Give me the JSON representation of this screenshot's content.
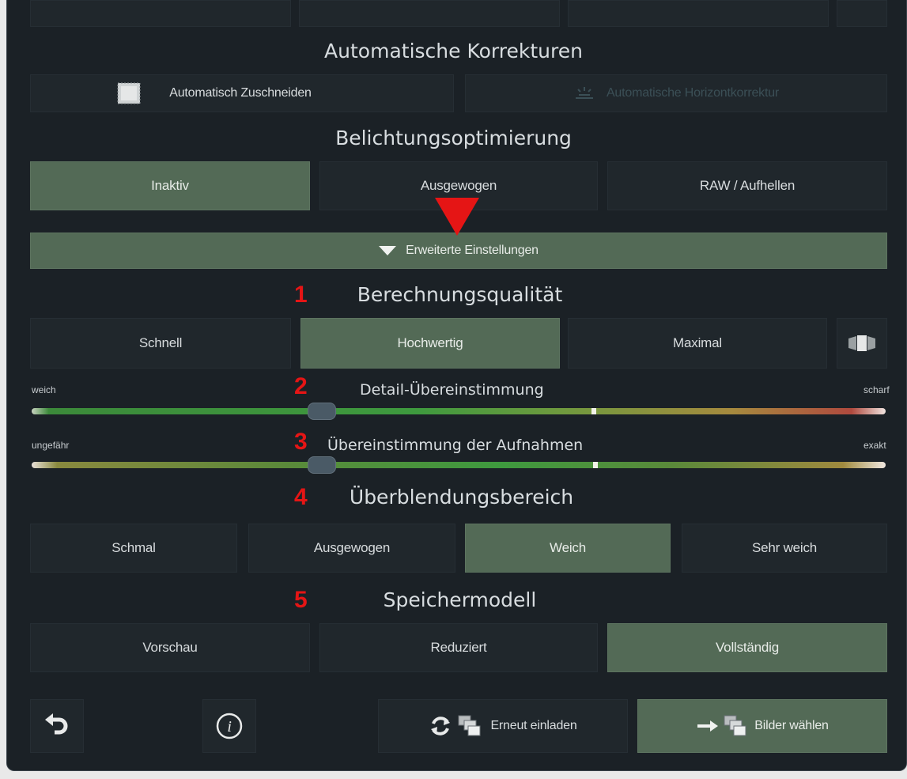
{
  "sections": {
    "auto_corrections": "Automatische Korrekturen",
    "exposure": "Belichtungsoptimierung",
    "quality": "Berechnungsqualität",
    "blending": "Überblendungsbereich",
    "memory": "Speichermodell"
  },
  "auto": {
    "crop": "Automatisch Zuschneiden",
    "horizon": "Automatische Horizontkorrektur"
  },
  "exposure_options": [
    "Inaktiv",
    "Ausgewogen",
    "RAW / Aufhellen"
  ],
  "advanced_toggle": "Erweiterte Einstellungen",
  "markers": [
    "1",
    "2",
    "3",
    "4",
    "5"
  ],
  "quality_options": [
    "Schnell",
    "Hochwertig",
    "Maximal"
  ],
  "detail_slider": {
    "label": "Detail-Übereinstimmung",
    "min_label": "weich",
    "max_label": "scharf",
    "value": 0.34
  },
  "match_slider": {
    "label": "Übereinstimmung der Aufnahmen",
    "min_label": "ungefähr",
    "max_label": "exakt",
    "value": 0.34
  },
  "blending_options": [
    "Schmal",
    "Ausgewogen",
    "Weich",
    "Sehr weich"
  ],
  "memory_options": [
    "Vorschau",
    "Reduziert",
    "Vollständig"
  ],
  "footer": {
    "reload": "Erneut einladen",
    "choose": "Bilder wählen"
  },
  "icons": [
    "crop-icon",
    "horizon-icon",
    "triangle-down-icon",
    "compare-icon",
    "undo-icon",
    "info-icon",
    "refresh-icon",
    "images-icon",
    "arrow-right-icon"
  ],
  "colors": {
    "background": "#1b2126",
    "button": "#20272c",
    "active": "#536a56",
    "annotation": "#e51515"
  }
}
